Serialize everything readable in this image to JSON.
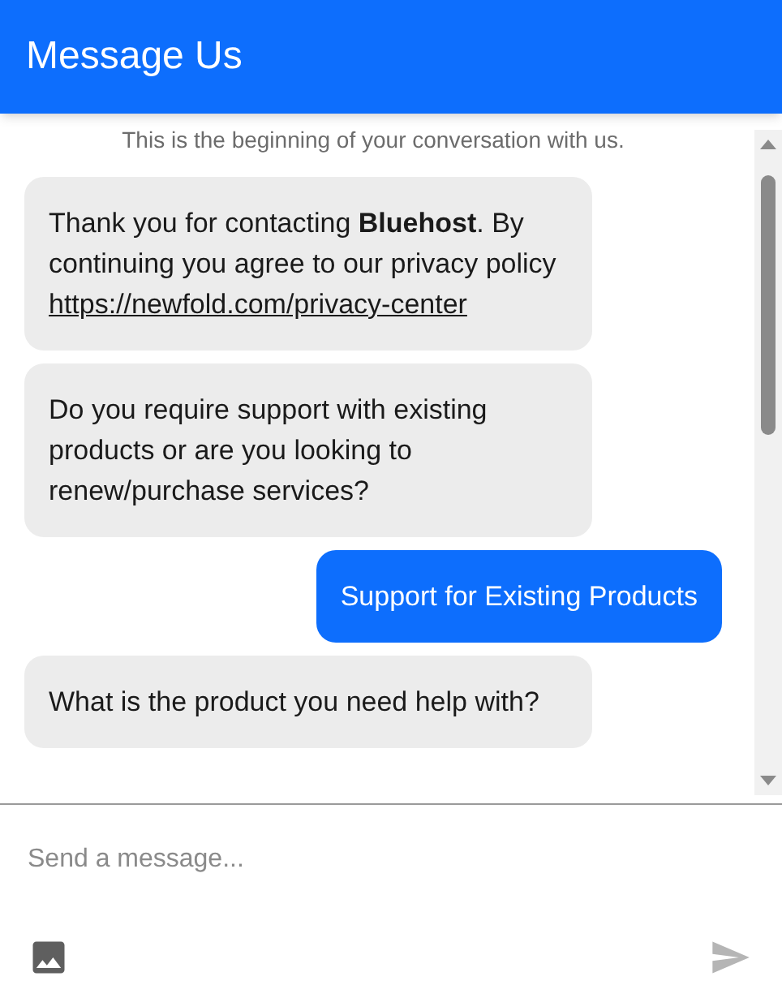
{
  "header": {
    "title": "Message Us"
  },
  "conversation": {
    "intro": "This is the beginning of your conversation with us.",
    "messages": [
      {
        "kind": "bot",
        "text": "Thank you for contacting **Bluehost**. By continuing you agree to our privacy policy",
        "link": "https://newfold.com/privacy-center"
      },
      {
        "kind": "bot",
        "text": "Do you require support with existing products or are you looking to renew/purchase services?"
      },
      {
        "kind": "user",
        "text": "Support for Existing Products"
      },
      {
        "kind": "bot",
        "text": "What is the product you need help with?"
      }
    ]
  },
  "composer": {
    "placeholder": "Send a message..."
  }
}
